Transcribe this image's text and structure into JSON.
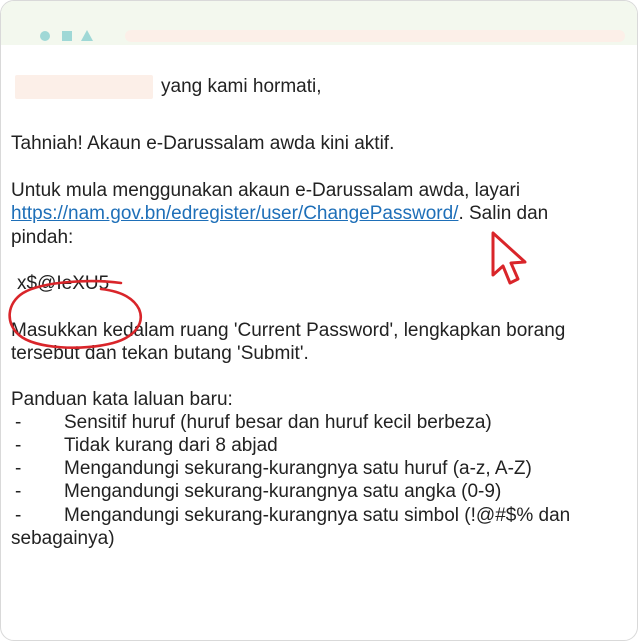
{
  "greeting_suffix": "yang kami hormati,",
  "line_congrats": "Tahniah! Akaun e-Darussalam awda kini aktif.",
  "line_instruction_1": "Untuk mula menggunakan akaun e-Darussalam awda, layari",
  "link_url": "https://nam.gov.bn/edregister/user/ChangePassword/",
  "line_instruction_2_suffix": ". Salin dan",
  "line_instruction_3": "pindah:",
  "temp_password": "x$@IeXU5",
  "line_current_1": "Masukkan kedalam ruang 'Current Password', lengkapkan borang",
  "line_current_2": "tersebut dan tekan butang 'Submit'.",
  "guide_heading": "Panduan kata laluan baru:",
  "guide_items": [
    {
      "dash": "-",
      "text": "Sensitif huruf (huruf besar dan huruf kecil berbeza)"
    },
    {
      "dash": "-",
      "text": "Tidak kurang dari 8 abjad"
    },
    {
      "dash": "-",
      "text": "Mengandungi sekurang-kurangnya satu huruf (a-z, A-Z)"
    },
    {
      "dash": "-",
      "text": "Mengandungi sekurang-kurangnya satu angka (0-9)"
    },
    {
      "dash": "-",
      "text": "Mengandungi sekurang-kurangnya satu simbol (!@#$% dan"
    }
  ],
  "guide_last_line": "sebagainya)",
  "colors": {
    "titlebar": "#f3f8ee",
    "window_controls": "#9fd8d6",
    "redaction": "#fcefe8",
    "link": "#1e6fb8",
    "annotation": "#d9252a"
  },
  "icons": [
    "circle-dot-icon",
    "square-icon",
    "triangle-icon",
    "cursor-arrow-icon"
  ]
}
